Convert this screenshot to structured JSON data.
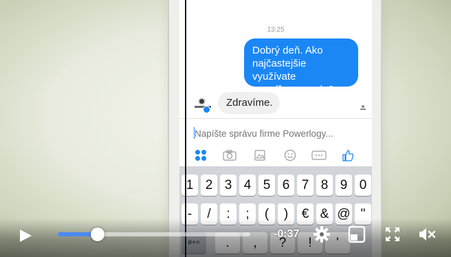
{
  "chat": {
    "timestamp": "13:25",
    "outgoing": [
      "Dobrý deň. Ako",
      "najčastejšie využívate",
      "mandľove maslo?"
    ],
    "incoming": "Zdravíme.",
    "composer_placeholder": "Napíšte správu firme Powerlogy..."
  },
  "toolbar_icons": [
    "apps-icon",
    "camera-icon",
    "gallery-icon",
    "emoji-icon",
    "gif-icon",
    "like-icon"
  ],
  "keyboard": {
    "row1": [
      "1",
      "2",
      "3",
      "4",
      "5",
      "6",
      "7",
      "8",
      "9",
      "0"
    ],
    "row2": [
      "-",
      "/",
      ":",
      ";",
      "(",
      ")",
      "€",
      "&",
      "@",
      "\""
    ],
    "row3": [
      "#+=",
      ".",
      ",",
      "?",
      "!",
      "'"
    ]
  },
  "video": {
    "time_remaining": "-0:37",
    "progress_fraction": 0.17,
    "knob_fraction": 0.17
  },
  "colors": {
    "bubble_out": "#1b87f5",
    "progress": "#4a8af0"
  }
}
